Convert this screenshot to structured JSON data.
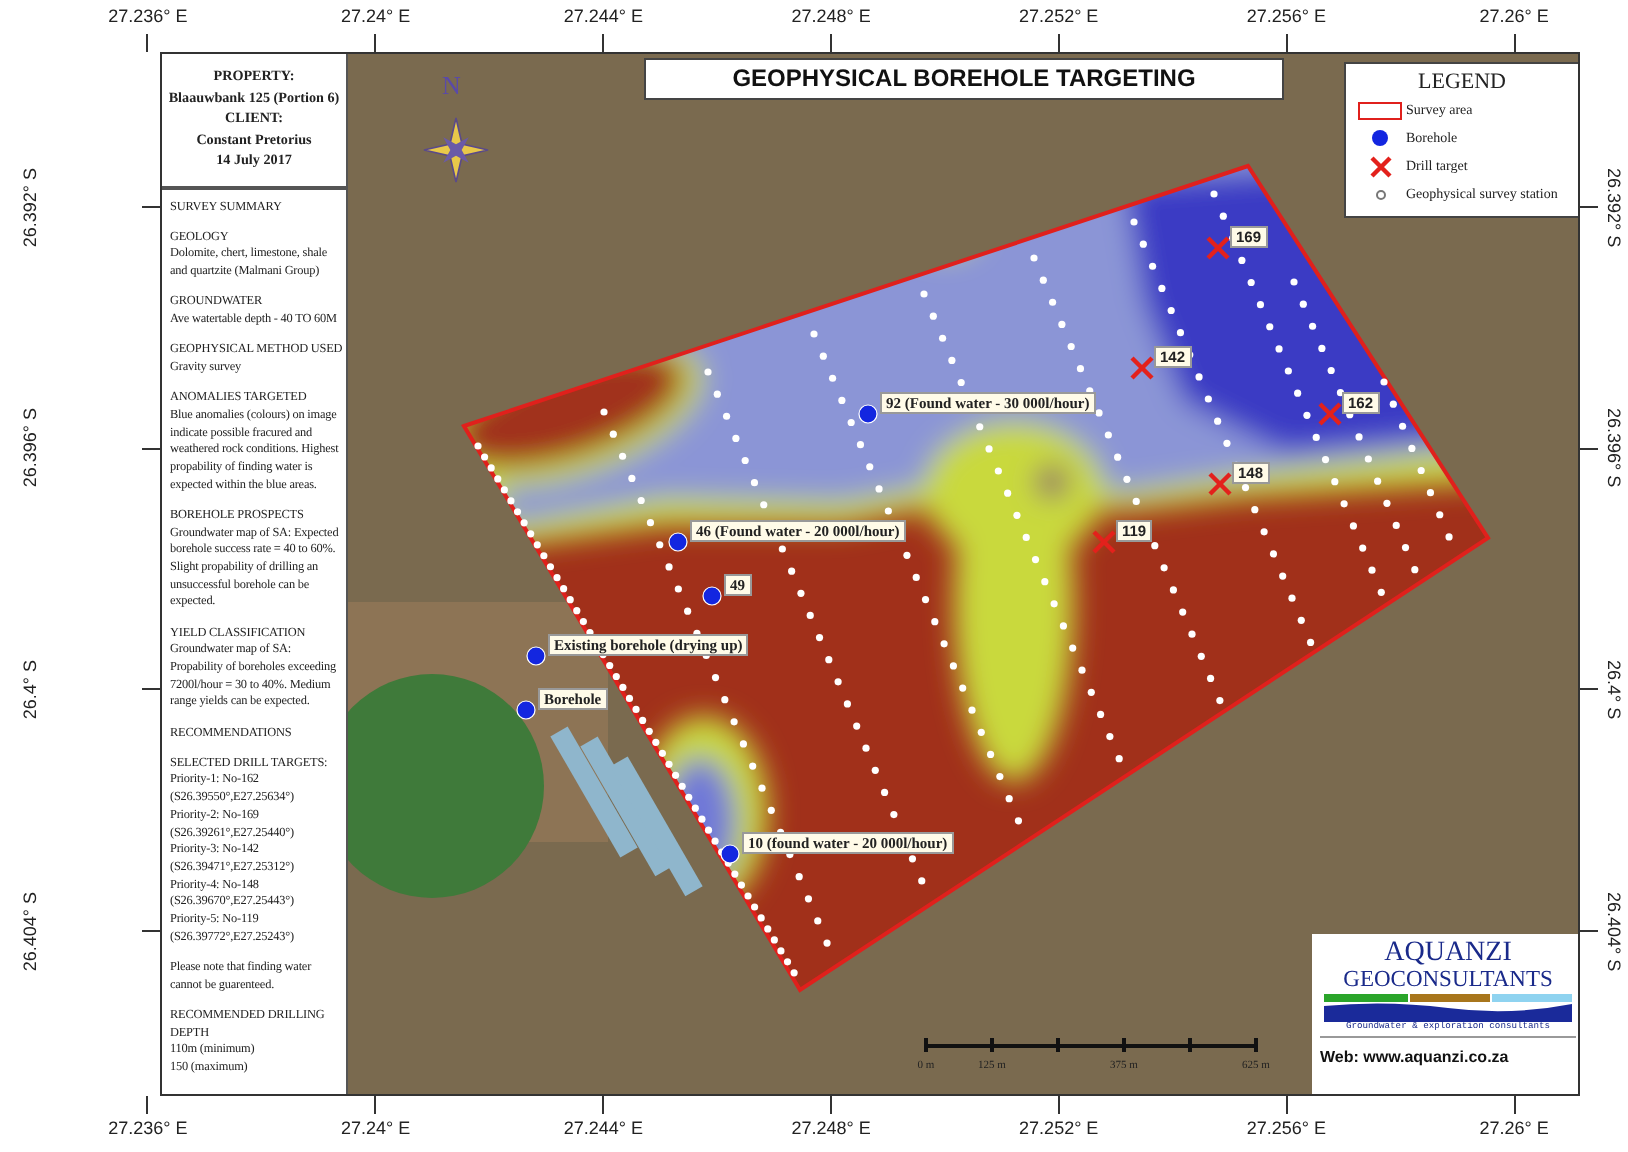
{
  "axes": {
    "top": [
      "27.236° E",
      "27.24° E",
      "27.244° E",
      "27.248° E",
      "27.252° E",
      "27.256° E",
      "27.26° E"
    ],
    "bottom": [
      "27.236° E",
      "27.24° E",
      "27.244° E",
      "27.248° E",
      "27.252° E",
      "27.256° E",
      "27.26° E"
    ],
    "left": [
      "26.392° S",
      "26.396° S",
      "26.4° S",
      "26.404° S"
    ],
    "right": [
      "26.392° S",
      "26.396° S",
      "26.4° S",
      "26.404° S"
    ]
  },
  "info_panel": {
    "header": [
      "PROPERTY:",
      "Blaauwbank 125 (Portion 6)",
      "CLIENT:",
      "Constant Pretorius",
      "14 July 2017"
    ],
    "sections": [
      {
        "heading": "SURVEY SUMMARY"
      },
      {
        "heading": "GEOLOGY",
        "text": "Dolomite, chert, limestone, shale and quartzite (Malmani Group)"
      },
      {
        "heading": "GROUNDWATER",
        "text": "Ave watertable depth - 40 TO 60M"
      },
      {
        "heading": "GEOPHYSICAL METHOD USED",
        "text": "Gravity survey"
      },
      {
        "heading": "ANOMALIES TARGETED",
        "text": "Blue anomalies (colours) on image indicate possible fracured and weathered rock conditions. Highest propability of finding water is expected within the blue areas."
      },
      {
        "heading": "BOREHOLE PROSPECTS",
        "text": "Groundwater map of SA: Expected borehole success rate = 40 to 60%.  Slight propability of drilling an unsuccessful borehole can be expected."
      },
      {
        "heading": "YIELD CLASSIFICATION",
        "text": "Groundwater map of SA: Propability of boreholes exceeding 7200l/hour = 30 to 40%. Medium range yields can be expected."
      },
      {
        "heading": "RECOMMENDATIONS"
      },
      {
        "heading": "SELECTED DRILL TARGETS:",
        "lines": [
          "Priority-1: No-162",
          "(S26.39550°,E27.25634°)",
          "Priority-2: No-169",
          "(S26.39261°,E27.25440°)",
          "Priority-3: No-142",
          "(S26.39471°,E27.25312°)",
          "Priority-4: No-148",
          "(S26.39670°,E27.25443°)",
          "Priority-5: No-119",
          "(S26.39772°,E27.25243°)"
        ]
      },
      {
        "text": "Please note that finding water cannot be guarenteed."
      },
      {
        "heading": "RECOMMENDED DRILLING DEPTH",
        "lines": [
          "110m (minimum)",
          "150 (maximum)"
        ]
      }
    ]
  },
  "map": {
    "title": "GEOPHYSICAL BOREHOLE TARGETING",
    "compass": {
      "label": "N"
    },
    "legend": {
      "title": "LEGEND",
      "items": [
        {
          "kind": "area",
          "label": "Survey area"
        },
        {
          "kind": "borehole",
          "label": "Borehole"
        },
        {
          "kind": "target",
          "label": "Drill target"
        },
        {
          "kind": "station",
          "label": "Geophysical survey station"
        }
      ]
    },
    "boreholes": [
      {
        "label": "92 (Found water - 30 000l/hour)"
      },
      {
        "label": "46 (Found water - 20 000l/hour)"
      },
      {
        "label": "49"
      },
      {
        "label": "Existing borehole (drying up)"
      },
      {
        "label": "Borehole"
      },
      {
        "label": "10 (found water - 20 000l/hour)"
      }
    ],
    "drill_targets": [
      {
        "label": "169"
      },
      {
        "label": "142"
      },
      {
        "label": "162"
      },
      {
        "label": "148"
      },
      {
        "label": "119"
      }
    ],
    "scale_bar": {
      "labels": [
        "0 m",
        "125 m",
        "375 m",
        "625 m"
      ]
    },
    "logo": {
      "line1": "AQUANZI",
      "line2": "GEOCONSULTANTS",
      "tagline": "Groundwater & exploration consultants",
      "web": "Web: www.aquanzi.co.za"
    }
  }
}
